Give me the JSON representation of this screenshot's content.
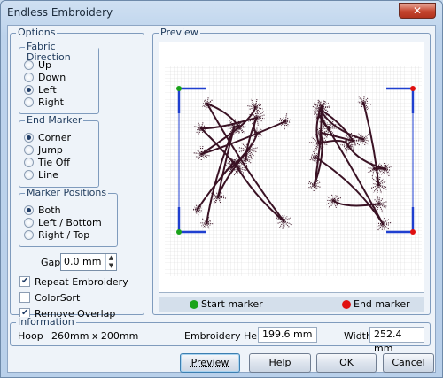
{
  "window": {
    "title": "Endless Embroidery",
    "close_glyph": "✕"
  },
  "options": {
    "legend": "Options",
    "fabric_direction": {
      "legend": "Fabric Direction",
      "items": [
        {
          "label": "Up",
          "selected": false
        },
        {
          "label": "Down",
          "selected": false
        },
        {
          "label": "Left",
          "selected": true
        },
        {
          "label": "Right",
          "selected": false
        }
      ]
    },
    "end_marker": {
      "legend": "End Marker",
      "items": [
        {
          "label": "Corner",
          "selected": true
        },
        {
          "label": "Jump",
          "selected": false
        },
        {
          "label": "Tie Off",
          "selected": false
        },
        {
          "label": "Line",
          "selected": false
        }
      ]
    },
    "marker_positions": {
      "legend": "Marker Positions",
      "items": [
        {
          "label": "Both",
          "selected": true
        },
        {
          "label": "Left / Bottom",
          "selected": false
        },
        {
          "label": "Right / Top",
          "selected": false
        }
      ]
    },
    "gap": {
      "label": "Gap",
      "value": "0.0 mm"
    },
    "checkboxes": [
      {
        "label": "Repeat Embroidery",
        "checked": true
      },
      {
        "label": "ColorSort",
        "checked": false
      },
      {
        "label": "Remove Overlap",
        "checked": true
      }
    ]
  },
  "preview": {
    "legend": "Preview",
    "start_marker_label": "Start marker",
    "end_marker_label": "End marker",
    "start_color": "#1aa31a",
    "end_color": "#e01010",
    "frame_color": "#1f3fd0",
    "design_color": "#3a1224"
  },
  "information": {
    "legend": "Information",
    "hoop_label": "Hoop",
    "hoop_value": "260mm x 200mm",
    "height_label": "Embroidery Height",
    "height_value": "199.6 mm",
    "width_label": "Width",
    "width_value": "252.4 mm"
  },
  "buttons": {
    "preview": "Preview",
    "help": "Help",
    "ok": "OK",
    "cancel": "Cancel"
  }
}
